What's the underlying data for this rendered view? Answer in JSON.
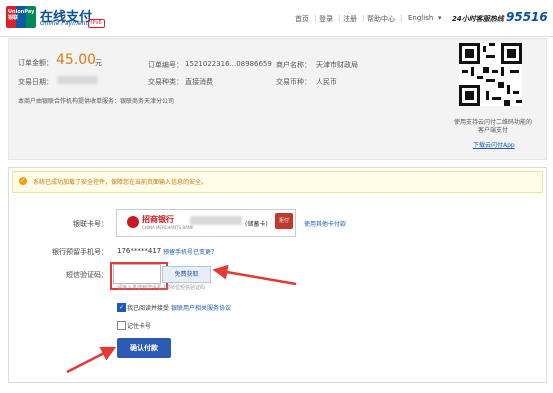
{
  "header": {
    "brand_logo_text": "UnionPay 银联",
    "brand_cn": "在线支付",
    "brand_en": "Online Payment",
    "ipv6": "IPv6",
    "nav": [
      "首页",
      "登录",
      "注册",
      "帮助中心",
      "English"
    ],
    "nav_sep": "|",
    "lang_caret": "▾",
    "hotline_label": "24小时客服热线",
    "hotline_number": "95516"
  },
  "order": {
    "amount_label": "订单金额：",
    "amount_value": "45.00",
    "amount_unit": "元",
    "order_no_label": "订单编号：",
    "order_no": "1521022316...08986659",
    "merchant_label": "商户名称：",
    "merchant": "天津市财政局",
    "date_label": "交易日期：",
    "type_label": "交易种类：",
    "type": "直接消费",
    "currency_label": "交易币种：",
    "currency": "人民币",
    "service_note": "本商户由银联合作机构提供收单服务：银联商务天津分公司",
    "qr_text": "使用支持云闪付二维码功能的客户端支付",
    "qr_link": "下载云闪付App"
  },
  "notice": {
    "icon": "✓",
    "text": "系统已成功加载了安全控件，保障您在当前页面输入信息的安全。"
  },
  "form": {
    "card_label": "银联卡号：",
    "bank_name": "招商银行",
    "bank_sub": "CHINA MERCHANTS BANK",
    "card_type": "(储蓄卡)",
    "card_tag": "拒付",
    "other_card_link": "使用其他卡付款",
    "phone_label": "银行预留手机号：",
    "phone": "176*****417",
    "phone_change_link": "预留手机号已变更？",
    "sms_label": "短信验证码：",
    "sms_value": "",
    "get_code_label": "免费获取",
    "sms_hint": "请输入发送到您手机上的6位短信验证码",
    "agree_text": "我已阅读并接受",
    "agree_link": "银联用户相关服务协议",
    "remember_text": "记住卡号",
    "confirm_label": "确认付款",
    "checkmark": "✓"
  },
  "colors": {
    "brand_blue": "#0b4f97",
    "amount_orange": "#e07a12",
    "button_blue": "#2b5bb4",
    "annotation_red": "#e53935"
  }
}
